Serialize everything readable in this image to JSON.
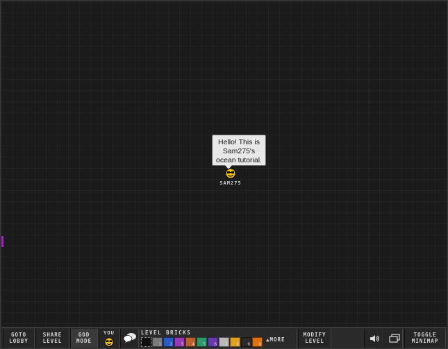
{
  "player": {
    "name": "SAM275",
    "speech": [
      "Hello! This is",
      "Sam275's",
      "ocean tutorial."
    ]
  },
  "toolbar": {
    "goto_lobby": [
      "GOTO",
      "LOBBY"
    ],
    "share_level": [
      "SHARE",
      "LEVEL"
    ],
    "god_mode": [
      "GOD",
      "MODE"
    ],
    "you_label": "YOU",
    "level_bricks_label": "LEVEL BRICKS",
    "more_label": "MORE",
    "modify_level": [
      "MODIFY",
      "LEVEL"
    ],
    "toggle_minimap": [
      "TOGGLE",
      "MINIMAP"
    ]
  },
  "bricks": [
    {
      "num": "",
      "color": "#111111"
    },
    {
      "num": "1",
      "color": "#7a7a7a"
    },
    {
      "num": "2",
      "color": "#2a5ac8"
    },
    {
      "num": "3",
      "color": "#9a3ab8"
    },
    {
      "num": "4",
      "color": "#b8622a"
    },
    {
      "num": "5",
      "color": "#2a9a6a"
    },
    {
      "num": "6",
      "color": "#6a3ab0"
    },
    {
      "num": "7",
      "color": "#b8b8b8"
    },
    {
      "num": "8",
      "color": "#e0a020"
    },
    {
      "num": "9",
      "color": "#2a2a2a"
    },
    {
      "num": "0",
      "color": "#e07010"
    }
  ],
  "colors": {
    "background": "#1b1b1b",
    "toolbar": "#2a2a2a",
    "bubble": "#e8e8e8",
    "smiley": "#f0c020",
    "edge_marker": "#a020c0"
  }
}
